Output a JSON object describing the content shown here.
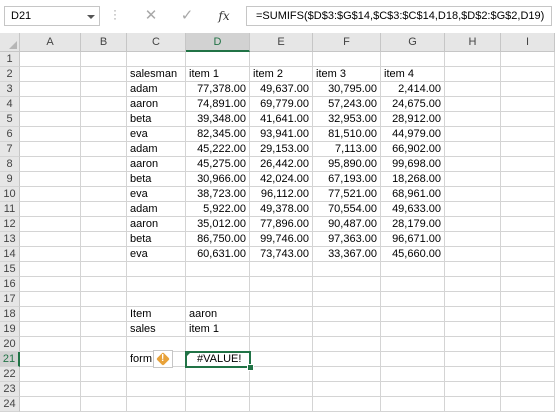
{
  "namebox": {
    "value": "D21"
  },
  "toolbar": {
    "cancel_glyph": "✕",
    "enter_glyph": "✓",
    "fx_label": "fx"
  },
  "formula": {
    "value": "=SUMIFS($D$3:$G$14,$C$3:$C$14,D18,$D$2:$G$2,D19)"
  },
  "columns": [
    "A",
    "B",
    "C",
    "D",
    "E",
    "F",
    "G",
    "H",
    "I"
  ],
  "rows": [
    "1",
    "2",
    "3",
    "4",
    "5",
    "6",
    "7",
    "8",
    "9",
    "10",
    "11",
    "12",
    "13",
    "14",
    "15",
    "16",
    "17",
    "18",
    "19",
    "20",
    "21",
    "22",
    "23",
    "24"
  ],
  "active": {
    "column": "D",
    "row": "21"
  },
  "table": {
    "header": [
      "salesman",
      "item 1",
      "item 2",
      "item 3",
      "item 4"
    ],
    "data": [
      [
        "adam",
        "77,378.00",
        "49,637.00",
        "30,795.00",
        "2,414.00"
      ],
      [
        "aaron",
        "74,891.00",
        "69,779.00",
        "57,243.00",
        "24,675.00"
      ],
      [
        "beta",
        "39,348.00",
        "41,641.00",
        "32,953.00",
        "28,912.00"
      ],
      [
        "eva",
        "82,345.00",
        "93,941.00",
        "81,510.00",
        "44,979.00"
      ],
      [
        "adam",
        "45,222.00",
        "29,153.00",
        "7,113.00",
        "66,902.00"
      ],
      [
        "aaron",
        "45,275.00",
        "26,442.00",
        "95,890.00",
        "99,698.00"
      ],
      [
        "beta",
        "30,966.00",
        "42,024.00",
        "67,193.00",
        "18,268.00"
      ],
      [
        "eva",
        "38,723.00",
        "96,112.00",
        "77,521.00",
        "68,961.00"
      ],
      [
        "adam",
        "5,922.00",
        "49,378.00",
        "70,554.00",
        "49,633.00"
      ],
      [
        "aaron",
        "35,012.00",
        "77,896.00",
        "90,487.00",
        "28,179.00"
      ],
      [
        "beta",
        "86,750.00",
        "99,746.00",
        "97,363.00",
        "96,671.00"
      ],
      [
        "eva",
        "60,631.00",
        "73,743.00",
        "33,367.00",
        "45,660.00"
      ]
    ]
  },
  "lookup": {
    "item_label": "Item",
    "item_value": "aaron",
    "sales_label": "sales",
    "sales_value": "item 1",
    "formula_label": "form",
    "result": "#VALUE!"
  },
  "icons": {
    "warning": "warning-icon"
  },
  "colors": {
    "accent": "#217346",
    "warning": "#e8a23a"
  }
}
